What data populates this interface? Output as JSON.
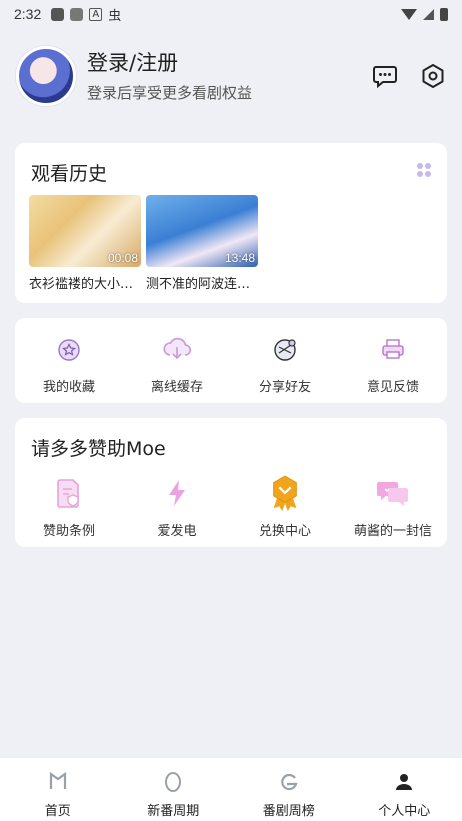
{
  "status_bar": {
    "time": "2:32"
  },
  "profile": {
    "title": "登录/注册",
    "subtitle": "登录后享受更多看剧权益",
    "icons": [
      "message-icon",
      "settings-gear-icon"
    ]
  },
  "history": {
    "title": "观看历史",
    "items": [
      {
        "name": "衣衫褴褛的大小…",
        "duration": "00:08"
      },
      {
        "name": "测不准的阿波连…",
        "duration": "13:48"
      }
    ]
  },
  "quick_actions": [
    {
      "label": "我的收藏",
      "icon": "favorite-star-icon"
    },
    {
      "label": "离线缓存",
      "icon": "cloud-download-icon"
    },
    {
      "label": "分享好友",
      "icon": "share-icon"
    },
    {
      "label": "意见反馈",
      "icon": "feedback-printer-icon"
    }
  ],
  "sponsor": {
    "title": "请多多赞助Moe",
    "items": [
      {
        "label": "赞助条例",
        "icon": "document-shield-icon"
      },
      {
        "label": "爱发电",
        "icon": "lightning-icon"
      },
      {
        "label": "兑换中心",
        "icon": "medal-icon"
      },
      {
        "label": "萌酱的一封信",
        "icon": "chat-bubbles-icon"
      }
    ]
  },
  "tabbar": [
    {
      "label": "首页",
      "icon": "home-icon"
    },
    {
      "label": "新番周期",
      "icon": "egg-icon"
    },
    {
      "label": "番剧周榜",
      "icon": "ranking-icon"
    },
    {
      "label": "个人中心",
      "icon": "profile-icon"
    }
  ],
  "colors": {
    "background": "#eef0f5",
    "accent_purple": "#c8b8ec",
    "medal_orange": "#f0a51c"
  }
}
